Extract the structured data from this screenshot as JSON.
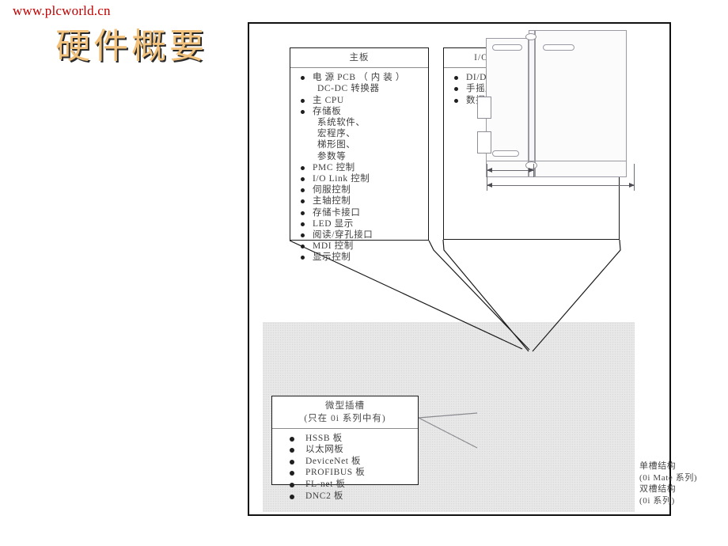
{
  "slide": {
    "watermark": "www.plcworld.cn",
    "title": "硬件概要"
  },
  "main_board": {
    "title": "主板",
    "items": [
      {
        "text": "电 源  PCB  （ 内 装 ）",
        "bullet": true
      },
      {
        "text": "DC-DC 转换器",
        "bullet": false
      },
      {
        "text": "主 CPU",
        "bullet": true
      },
      {
        "text": "存储板",
        "bullet": true
      },
      {
        "text": "系统软件、",
        "bullet": false
      },
      {
        "text": "宏程序、",
        "bullet": false
      },
      {
        "text": "梯形图、",
        "bullet": false
      },
      {
        "text": "参数等",
        "bullet": false
      },
      {
        "text": "PMC 控制",
        "bullet": true
      },
      {
        "text": "I/O Link  控制",
        "bullet": true
      },
      {
        "text": "伺服控制",
        "bullet": true
      },
      {
        "text": "主轴控制",
        "bullet": true
      },
      {
        "text": "存储卡接口",
        "bullet": true
      },
      {
        "text": "LED  显示",
        "bullet": true
      },
      {
        "text": "阅读/穿孔接口",
        "bullet": true
      },
      {
        "text": "MDI  控制",
        "bullet": true
      },
      {
        "text": "显示控制",
        "bullet": true
      }
    ]
  },
  "io_board": {
    "title": "I/O  板 （只用于 0i 系列）",
    "items": [
      {
        "text": "DI/DO",
        "bullet": true
      },
      {
        "text": "手摇脉冲发生器控制",
        "bullet": true
      },
      {
        "text": "数据服务器",
        "bullet": true
      }
    ]
  },
  "micro_slot": {
    "title_line1": "微型插槽",
    "title_line2": "(只在 0i 系列中有)",
    "items": [
      {
        "text": "HSSB 板",
        "bullet": true
      },
      {
        "text": "以太网板",
        "bullet": true
      },
      {
        "text": "DeviceNet 板",
        "bullet": true
      },
      {
        "text": "PROFIBUS  板",
        "bullet": true
      },
      {
        "text": "FL-net  板",
        "bullet": true
      },
      {
        "text": "DNC2 板",
        "bullet": true
      }
    ]
  },
  "structure_caption": {
    "line1": "单槽结构",
    "line2": "(0i Mate  系列)",
    "line3": "双槽结构",
    "line4": "(0i  系列)"
  },
  "colors": {
    "watermark": "#c00000",
    "title_fill": "#f2c27c",
    "title_shadow": "#2a2a2a",
    "frame_border": "#111111",
    "machine_area_bg": "#f4f4f4",
    "text": "#3f3f3f"
  }
}
